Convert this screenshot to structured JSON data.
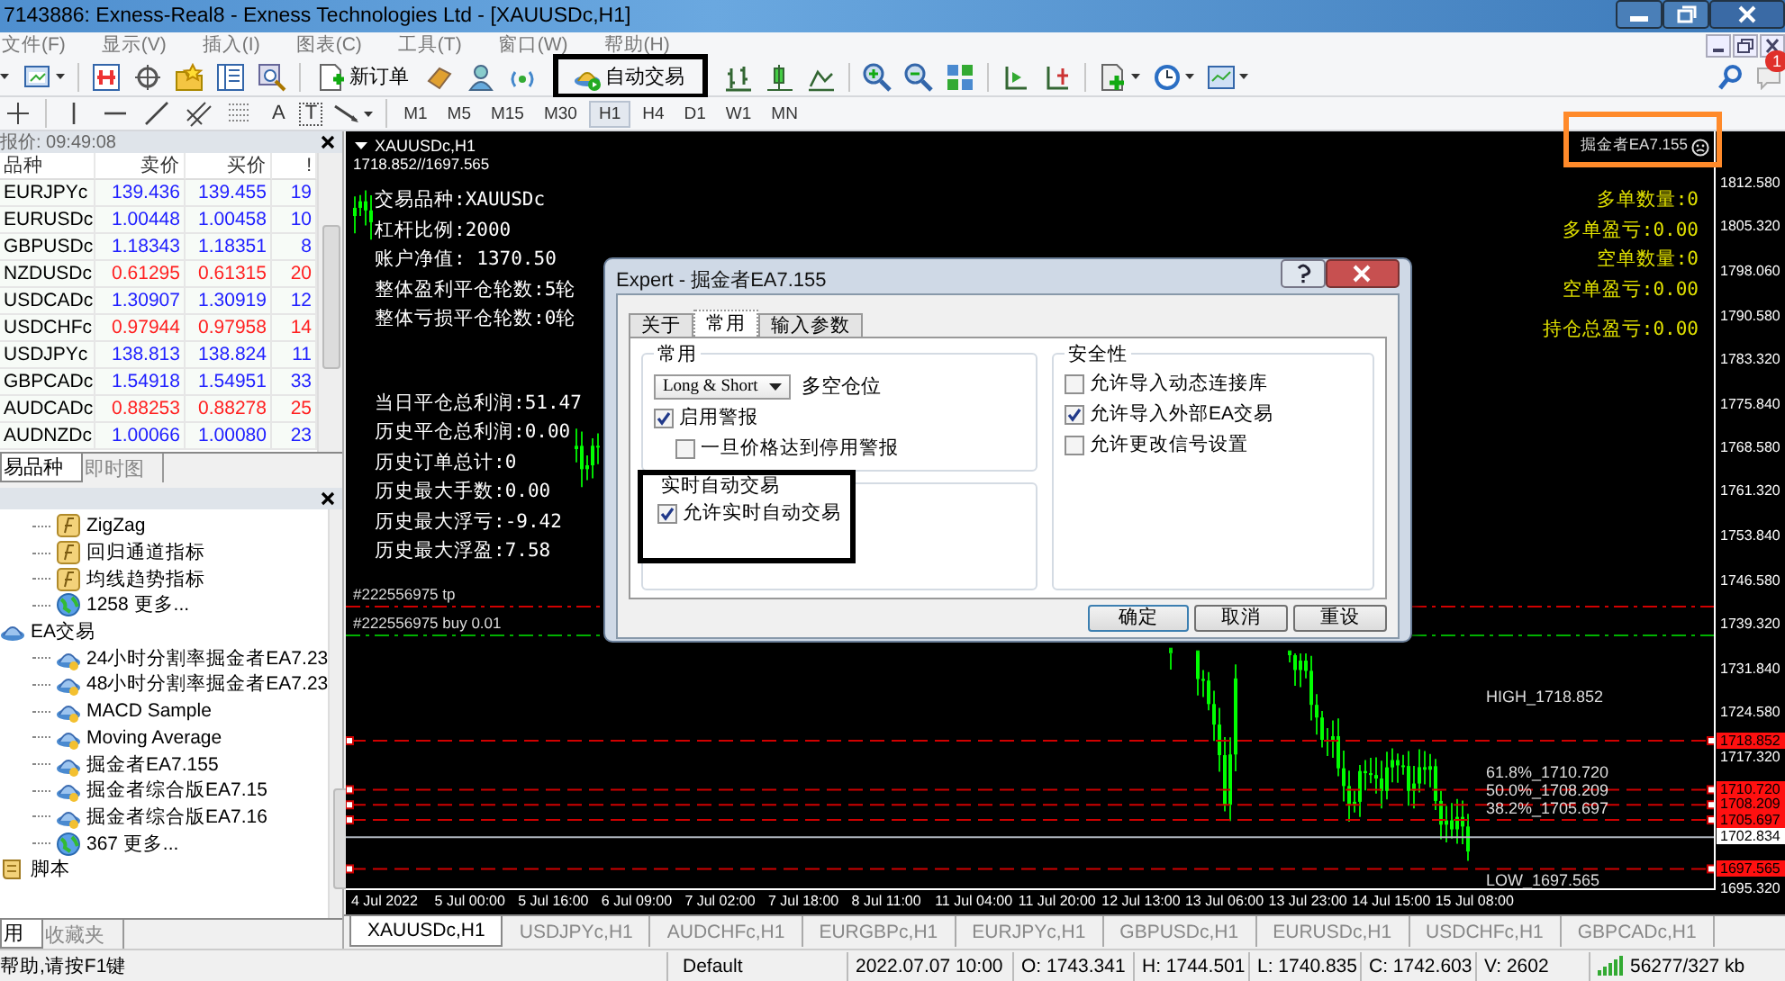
{
  "window": {
    "title": "7143886: Exness-Real8 - Exness Technologies Ltd - [XAUUSDc,H1]"
  },
  "menu": [
    "文件(F)",
    "显示(V)",
    "插入(I)",
    "图表(C)",
    "工具(T)",
    "窗口(W)",
    "帮助(H)"
  ],
  "toolbar": {
    "buttons": [
      {
        "label": "新订单",
        "annotated": false
      },
      {
        "label": "自动交易",
        "annotated": true
      }
    ],
    "notification_badge": "1",
    "drawing_tools": {
      "text_tool": "A",
      "label_tool": "T"
    },
    "timeframes": [
      {
        "label": "M1",
        "selected": false
      },
      {
        "label": "M5",
        "selected": false
      },
      {
        "label": "M15",
        "selected": false
      },
      {
        "label": "M30",
        "selected": false
      },
      {
        "label": "H1",
        "selected": true
      },
      {
        "label": "H4",
        "selected": false
      },
      {
        "label": "D1",
        "selected": false
      },
      {
        "label": "W1",
        "selected": false
      },
      {
        "label": "MN",
        "selected": false
      }
    ]
  },
  "market_watch": {
    "title": "报价: 09:49:08",
    "columns": [
      "品种",
      "卖价",
      "买价",
      "!"
    ],
    "rows": [
      {
        "symbol": "EURJPYc",
        "bid": "139.436",
        "ask": "139.455",
        "spread": "19",
        "color": "#2020ff"
      },
      {
        "symbol": "EURUSDc",
        "bid": "1.00448",
        "ask": "1.00458",
        "spread": "10",
        "color": "#2020ff"
      },
      {
        "symbol": "GBPUSDc",
        "bid": "1.18343",
        "ask": "1.18351",
        "spread": "8",
        "color": "#2020ff"
      },
      {
        "symbol": "NZDUSDc",
        "bid": "0.61295",
        "ask": "0.61315",
        "spread": "20",
        "color": "#ff2020"
      },
      {
        "symbol": "USDCADc",
        "bid": "1.30907",
        "ask": "1.30919",
        "spread": "12",
        "color": "#2020ff"
      },
      {
        "symbol": "USDCHFc",
        "bid": "0.97944",
        "ask": "0.97958",
        "spread": "14",
        "color": "#ff2020"
      },
      {
        "symbol": "USDJPYc",
        "bid": "138.813",
        "ask": "138.824",
        "spread": "11",
        "color": "#2020ff"
      },
      {
        "symbol": "GBPCADc",
        "bid": "1.54918",
        "ask": "1.54951",
        "spread": "33",
        "color": "#2020ff"
      },
      {
        "symbol": "AUDCADc",
        "bid": "0.88253",
        "ask": "0.88278",
        "spread": "25",
        "color": "#ff2020"
      },
      {
        "symbol": "AUDNZDc",
        "bid": "1.00066",
        "ask": "1.00080",
        "spread": "23",
        "color": "#2020ff"
      }
    ],
    "tabs": [
      {
        "label": "易品种",
        "selected": true
      },
      {
        "label": "即时图",
        "selected": false
      }
    ]
  },
  "navigator": {
    "tree": [
      {
        "kind": "partial",
        "children": [
          {
            "label": "ZigZag",
            "kind": "indicator"
          },
          {
            "label": "回归通道指标",
            "kind": "indicator"
          },
          {
            "label": "均线趋势指标",
            "kind": "indicator"
          },
          {
            "label": "1258 更多...",
            "kind": "more"
          }
        ]
      },
      {
        "label": "EA交易",
        "kind": "folder",
        "children": [
          {
            "label": "24小时分割率掘金者EA7.23",
            "kind": "expert"
          },
          {
            "label": "48小时分割率掘金者EA7.23",
            "kind": "expert"
          },
          {
            "label": "MACD Sample",
            "kind": "expert"
          },
          {
            "label": "Moving Average",
            "kind": "expert"
          },
          {
            "label": "掘金者EA7.155",
            "kind": "expert"
          },
          {
            "label": "掘金者综合版EA7.15",
            "kind": "expert"
          },
          {
            "label": "掘金者综合版EA7.16",
            "kind": "expert"
          },
          {
            "label": "367 更多...",
            "kind": "more"
          }
        ]
      },
      {
        "label": "脚本",
        "kind": "script"
      }
    ],
    "tabs": [
      {
        "label": "用",
        "selected": true
      },
      {
        "label": "收藏夹",
        "selected": false
      }
    ]
  },
  "status_hint": "帮助,请按F1键",
  "chart": {
    "title": "XAUUSDc,H1",
    "range": "1718.852//1697.565",
    "ea_label": {
      "text": "掘金者EA7.155",
      "annotated": true
    },
    "info_blocks": [
      [
        "交易品种:XAUUSDc",
        "杠杆比例:2000",
        "账户净值: 1370.50",
        "整体盈利平仓轮数:5轮",
        "整体亏损平仓轮数:0轮"
      ],
      [
        "当日平仓总利润:51.47",
        "历史平仓总利润:0.00",
        "历史订单总计:0",
        "历史最大手数:0.00",
        "历史最大浮亏:-9.42",
        "历史最大浮盈:7.58"
      ]
    ],
    "position_blocks": [
      [
        "多单数量:0",
        "多单盈亏:0.00",
        "空单数量:0",
        "空单盈亏:0.00"
      ],
      [
        "持仓总盈亏:0.00"
      ]
    ],
    "price_ticks": [
      "1812.580",
      "1805.320",
      "1798.060",
      "1790.580",
      "1783.320",
      "1775.840",
      "1768.580",
      "1761.320",
      "1753.840",
      "1746.580",
      "1739.320",
      "1731.840",
      "1724.580",
      "1717.320",
      "1695.320"
    ],
    "time_ticks": [
      "4 Jul 2022",
      "5 Jul 00:00",
      "5 Jul 16:00",
      "6 Jul 09:00",
      "7 Jul 02:00",
      "7 Jul 18:00",
      "8 Jul 11:00",
      "11 Jul 04:00",
      "11 Jul 20:00",
      "12 Jul 13:00",
      "13 Jul 06:00",
      "13 Jul 23:00",
      "14 Jul 15:00",
      "15 Jul 08:00"
    ],
    "levels": [
      {
        "kind": "high",
        "label": "HIGH_1718.852",
        "tag": "1718.852"
      },
      {
        "kind": "fib",
        "label": "61.8%_1710.720",
        "tag": "1710.720"
      },
      {
        "kind": "fib",
        "label": "50.0%_1708.209",
        "tag": "1708.209"
      },
      {
        "kind": "fib",
        "label": "38.2%_1705.697",
        "tag": "1705.697"
      },
      {
        "kind": "low",
        "label": "LOW_1697.565",
        "tag": "1697.565"
      }
    ],
    "current_price": "1702.834",
    "order_lines": [
      {
        "kind": "tp",
        "label": "#222556975 tp"
      },
      {
        "kind": "buy",
        "label": "#222556975 buy 0.01"
      }
    ]
  },
  "dialog": {
    "title": "Expert - 掘金者EA7.155",
    "tabs": [
      {
        "label": "关于",
        "selected": false
      },
      {
        "label": "常用",
        "selected": true
      },
      {
        "label": "输入参数",
        "selected": false
      }
    ],
    "groups": [
      {
        "kind": "common",
        "title": "常用",
        "annotated": false,
        "dropdown": "Long & Short",
        "dropdown_label": "多空仓位",
        "options": [
          {
            "label": "启用警报",
            "checked": true,
            "children": [
              {
                "label": "一旦价格达到停用警报",
                "checked": false
              }
            ]
          }
        ]
      },
      {
        "kind": "live",
        "title": "实时自动交易",
        "annotated": true,
        "options": [
          {
            "label": "允许实时自动交易",
            "checked": true
          }
        ]
      },
      {
        "kind": "safety",
        "title": "安全性",
        "annotated": false,
        "options": [
          {
            "label": "允许导入动态连接库",
            "checked": false
          },
          {
            "label": "允许导入外部EA交易",
            "checked": true
          },
          {
            "label": "允许更改信号设置",
            "checked": false
          }
        ]
      }
    ],
    "buttons": [
      "确定",
      "取消",
      "重设"
    ]
  },
  "chart_tabs": [
    {
      "label": "XAUUSDc,H1",
      "selected": true
    },
    {
      "label": "USDJPYc,H1",
      "selected": false
    },
    {
      "label": "AUDCHFc,H1",
      "selected": false
    },
    {
      "label": "EURGBPc,H1",
      "selected": false
    },
    {
      "label": "EURJPYc,H1",
      "selected": false
    },
    {
      "label": "GBPUSDc,H1",
      "selected": false
    },
    {
      "label": "EURUSDc,H1",
      "selected": false
    },
    {
      "label": "USDCHFc,H1",
      "selected": false
    },
    {
      "label": "GBPCADc,H1",
      "selected": false
    }
  ],
  "status_bar": [
    "Default",
    "2022.07.07 10:00",
    "O: 1743.341",
    "H: 1744.501",
    "L: 1740.835",
    "C: 1742.603",
    "V: 2602",
    "56277/327 kb"
  ]
}
